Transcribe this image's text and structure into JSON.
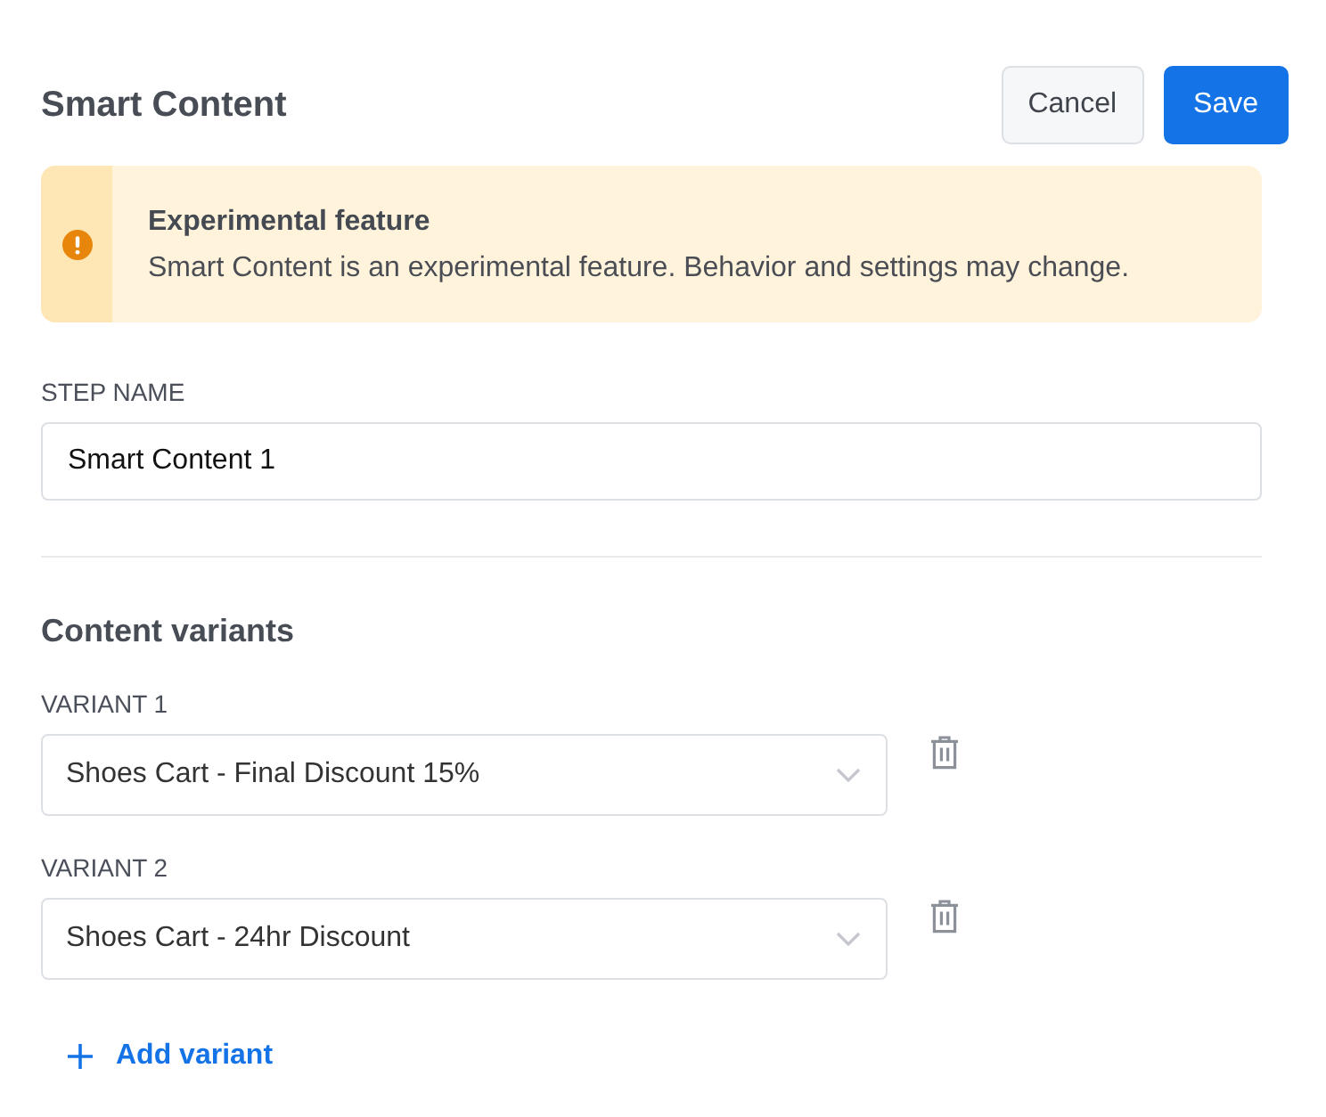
{
  "header": {
    "title": "Smart Content",
    "buttons": [
      {
        "label": "Cancel",
        "kind": "secondary"
      },
      {
        "label": "Save",
        "kind": "primary"
      }
    ]
  },
  "callout": {
    "kind": "warning",
    "title": "Experimental feature",
    "message": "Smart Content is an experimental feature. Behavior and settings may change."
  },
  "step_name": {
    "label": "STEP NAME",
    "value": "Smart Content 1"
  },
  "variants_section": {
    "title": "Content variants",
    "variants": [
      {
        "label": "VARIANT 1",
        "value": "Shoes Cart - Final Discount 15%"
      },
      {
        "label": "VARIANT 2",
        "value": "Shoes Cart - 24hr Discount"
      }
    ],
    "add_button": {
      "label": "Add variant"
    }
  }
}
